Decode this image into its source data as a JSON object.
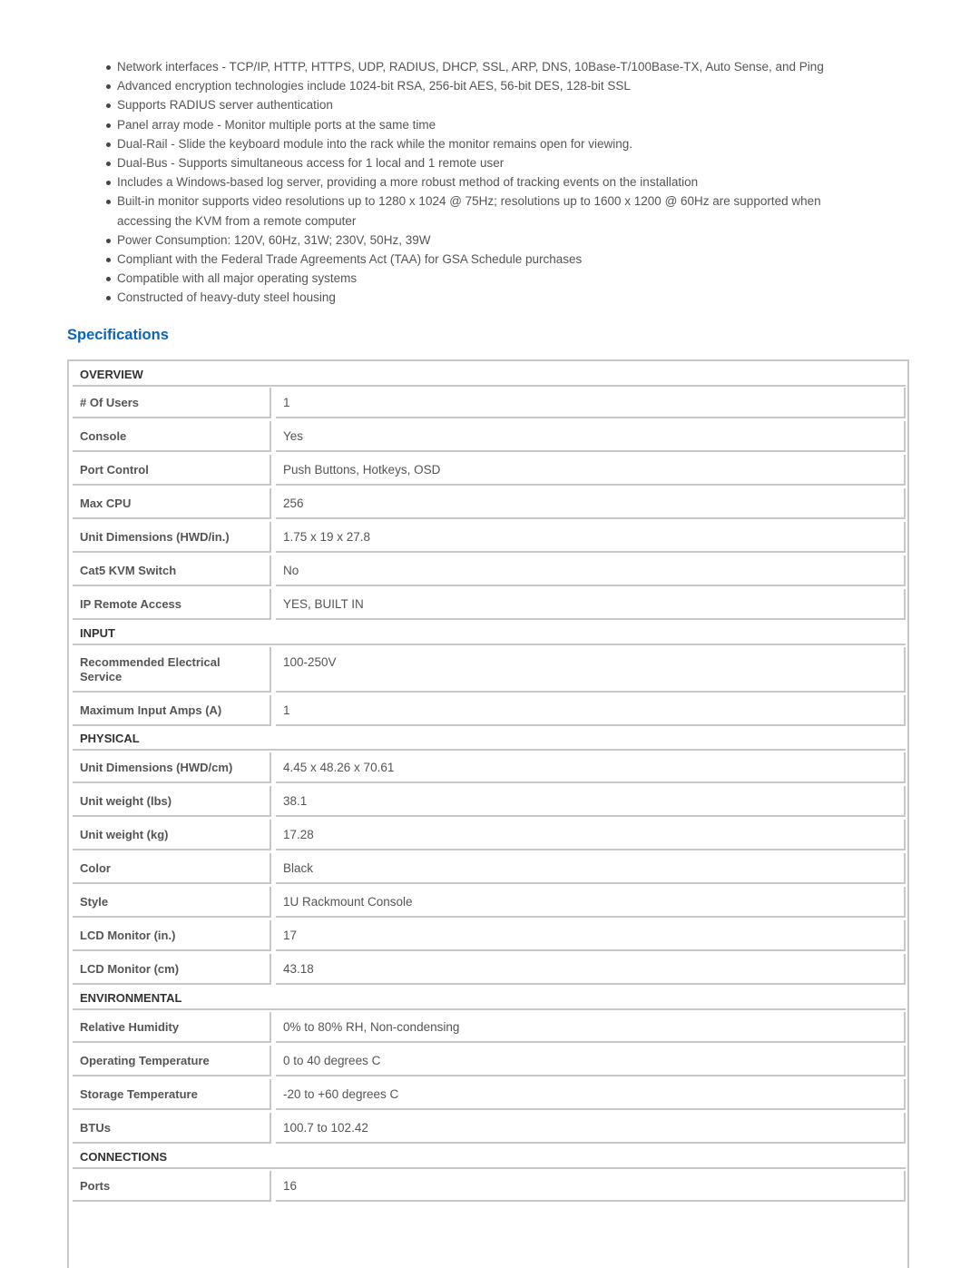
{
  "features": [
    "Network interfaces - TCP/IP, HTTP, HTTPS, UDP, RADIUS, DHCP, SSL, ARP, DNS, 10Base-T/100Base-TX, Auto Sense, and Ping",
    "Advanced encryption technologies include 1024-bit RSA, 256-bit AES, 56-bit DES, 128-bit SSL",
    "Supports RADIUS server authentication",
    "Panel array mode - Monitor multiple ports at the same time",
    "Dual-Rail - Slide the keyboard module into the rack while the monitor remains open for viewing.",
    "Dual-Bus - Supports simultaneous access for 1 local and 1 remote user",
    "Includes a Windows-based log server, providing a more robust method of tracking events on the installation",
    "Built-in monitor supports video resolutions up to 1280 x 1024 @ 75Hz; resolutions up to 1600 x 1200 @ 60Hz are supported when accessing the KVM from a remote computer",
    "Power Consumption: 120V, 60Hz, 31W; 230V, 50Hz, 39W",
    "Compliant with the Federal Trade Agreements Act (TAA) for GSA Schedule purchases",
    "Compatible with all major operating systems",
    "Constructed of heavy-duty steel housing"
  ],
  "specifications": {
    "title": "Specifications",
    "sections": [
      {
        "header": "OVERVIEW",
        "rows": [
          {
            "label": "# Of Users",
            "value": "1"
          },
          {
            "label": "Console",
            "value": "Yes"
          },
          {
            "label": "Port Control",
            "value": "Push Buttons, Hotkeys, OSD"
          },
          {
            "label": "Max CPU",
            "value": "256"
          },
          {
            "label": "Unit Dimensions (HWD/in.)",
            "value": "1.75 x 19 x 27.8"
          },
          {
            "label": "Cat5 KVM Switch",
            "value": "No"
          },
          {
            "label": "IP Remote Access",
            "value": "YES, BUILT IN"
          }
        ]
      },
      {
        "header": "INPUT",
        "rows": [
          {
            "label": "Recommended Electrical Service",
            "value": "100-250V"
          },
          {
            "label": "Maximum Input Amps (A)",
            "value": "1"
          }
        ]
      },
      {
        "header": "PHYSICAL",
        "rows": [
          {
            "label": "Unit Dimensions (HWD/cm)",
            "value": "4.45 x 48.26 x 70.61"
          },
          {
            "label": "Unit weight (lbs)",
            "value": "38.1"
          },
          {
            "label": "Unit weight (kg)",
            "value": "17.28"
          },
          {
            "label": "Color",
            "value": "Black"
          },
          {
            "label": "Style",
            "value": "1U Rackmount Console"
          },
          {
            "label": "LCD Monitor (in.)",
            "value": "17"
          },
          {
            "label": "LCD Monitor (cm)",
            "value": "43.18"
          }
        ]
      },
      {
        "header": "ENVIRONMENTAL",
        "rows": [
          {
            "label": "Relative Humidity",
            "value": "0% to 80% RH, Non-condensing"
          },
          {
            "label": "Operating Temperature",
            "value": "0 to 40 degrees C"
          },
          {
            "label": "Storage Temperature",
            "value": "-20 to +60 degrees C"
          },
          {
            "label": "BTUs",
            "value": "100.7 to 102.42"
          }
        ]
      },
      {
        "header": "CONNECTIONS",
        "rows": [
          {
            "label": "Ports",
            "value": "16"
          }
        ]
      }
    ]
  }
}
